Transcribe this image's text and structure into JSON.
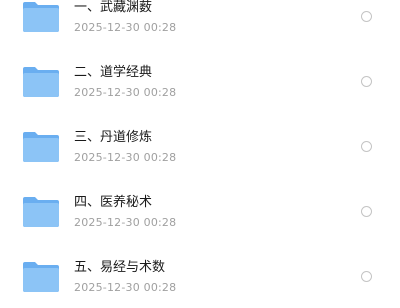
{
  "files": [
    {
      "name": "一、武藏渊薮",
      "date": "2025-12-30 00:28",
      "icon": "folder-icon"
    },
    {
      "name": "二、道学经典",
      "date": "2025-12-30 00:28",
      "icon": "folder-icon"
    },
    {
      "name": "三、丹道修炼",
      "date": "2025-12-30 00:28",
      "icon": "folder-icon"
    },
    {
      "name": "四、医养秘术",
      "date": "2025-12-30 00:28",
      "icon": "folder-icon"
    },
    {
      "name": "五、易经与术数",
      "date": "2025-12-30 00:28",
      "icon": "folder-icon"
    }
  ],
  "colors": {
    "folder_back": "#6aaef0",
    "folder_front": "#8cc4f6",
    "title": "#1a1a1a",
    "date": "#a0a0a0",
    "radio_border": "#c4c4c4"
  }
}
